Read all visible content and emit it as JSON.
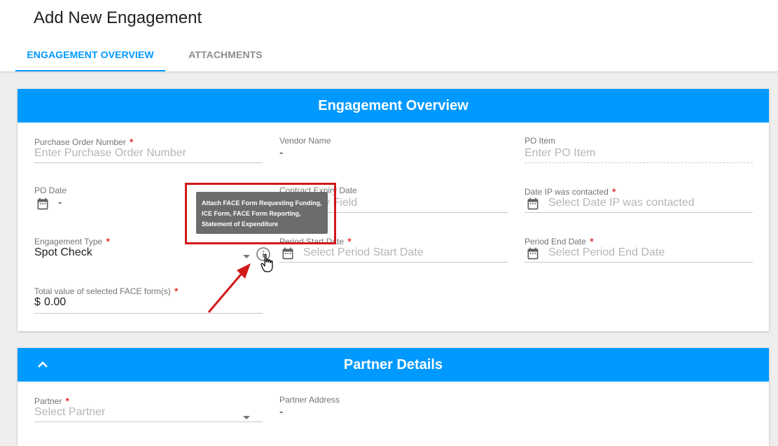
{
  "header": {
    "title": "Add New Engagement",
    "tabs": [
      {
        "label": "ENGAGEMENT OVERVIEW",
        "active": true
      },
      {
        "label": "ATTACHMENTS",
        "active": false
      }
    ]
  },
  "overview": {
    "title": "Engagement Overview",
    "fields": {
      "po_number": {
        "label": "Purchase Order Number",
        "required": "*",
        "placeholder": "Enter Purchase Order Number"
      },
      "vendor_name": {
        "label": "Vendor Name",
        "value": "-"
      },
      "po_item": {
        "label": "PO Item",
        "placeholder": "Enter PO Item"
      },
      "po_date": {
        "label": "PO Date",
        "value": "-"
      },
      "contract_expiry": {
        "label": "Contract Expiry Date",
        "placeholder": "Read only Field"
      },
      "date_ip_contacted": {
        "label": "Date IP was contacted",
        "required": "*",
        "placeholder": "Select Date IP was contacted"
      },
      "engagement_type": {
        "label": "Engagement Type",
        "required": "*",
        "value": "Spot Check"
      },
      "period_start": {
        "label": "Period Start Date",
        "required": "*",
        "placeholder": "Select Period Start Date"
      },
      "period_end": {
        "label": "Period End Date",
        "required": "*",
        "placeholder": "Select Period End Date"
      },
      "face_total": {
        "label": "Total value of selected FACE form(s)",
        "required": "*",
        "currency": "$",
        "value": "0.00"
      }
    },
    "tooltip": {
      "lines": [
        "Attach FACE Form Requesting Funding,",
        "ICE Form, FACE Form Reporting,",
        "Statement of Expenditure"
      ]
    }
  },
  "partner": {
    "title": "Partner Details",
    "fields": {
      "partner": {
        "label": "Partner",
        "required": "*",
        "placeholder": "Select Partner"
      },
      "partner_address": {
        "label": "Partner Address",
        "value": "-"
      }
    }
  },
  "colors": {
    "accent": "#0099ff",
    "required": "#e00000",
    "annotation": "#d11a1a",
    "tooltip_bg": "#6c6c6c"
  },
  "icons": [
    "calendar-icon",
    "info-icon",
    "chevron-up-icon",
    "dropdown-arrow-icon",
    "hand-cursor-icon"
  ]
}
